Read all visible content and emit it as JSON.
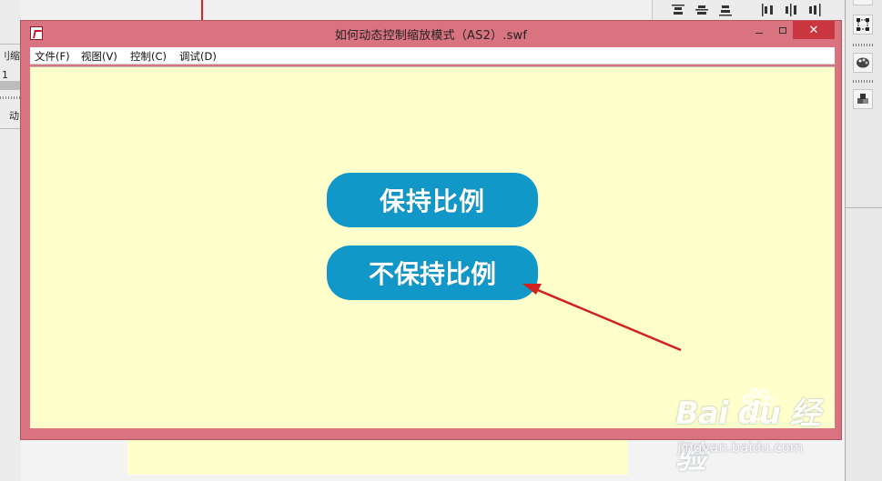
{
  "ide": {
    "left_panel_lines": [
      "刂缩放",
      "1",
      "动"
    ]
  },
  "window": {
    "title": "如何动态控制缩放模式（AS2）.swf",
    "close_glyph": "✕"
  },
  "menu": [
    {
      "label": "文件(F)"
    },
    {
      "label": "视图(V)"
    },
    {
      "label": "控制(C)"
    },
    {
      "label": "调试(D)"
    }
  ],
  "stage": {
    "keep_ratio_button": "保持比例",
    "no_keep_ratio_button": "不保持比例",
    "arrow_color": "#d0211f",
    "button_color": "#1198c8",
    "background_color": "#ffffcc"
  },
  "watermark": {
    "logo": "Bai du 经验",
    "url": "jingyan.baidu.com"
  },
  "colors": {
    "window_frame": "#d97380",
    "close_button": "#c9363f"
  }
}
